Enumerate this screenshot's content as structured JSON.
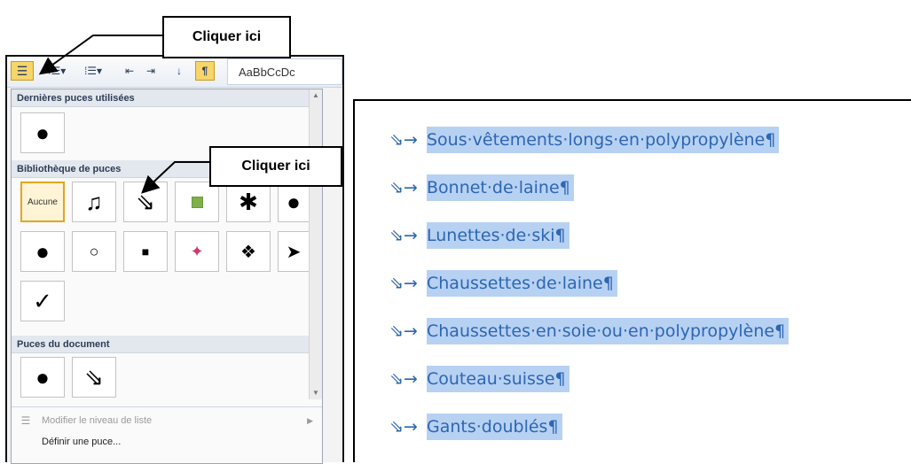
{
  "callouts": [
    "Cliquer ici",
    "Cliquer ici"
  ],
  "ribbon": {
    "styles_preview": "AaBbCcDc",
    "buttons": [
      "bullets-icon",
      "numbering-icon",
      "multilevel-list-icon",
      "decrease-indent-icon",
      "increase-indent-icon",
      "sort-icon",
      "pilcrow-icon"
    ]
  },
  "dropdown": {
    "recent_header": "Dernières puces utilisées",
    "library_header": "Bibliothèque de puces",
    "none_label": "Aucune",
    "document_header": "Puces du document",
    "change_level": "Modifier le niveau de liste",
    "define_bullet": "Définir une puce..."
  },
  "document": {
    "items": [
      "Sous·vêtements·longs·en·polypropylène¶",
      "Bonnet·de·laine¶",
      "Lunettes·de·ski¶",
      "Chaussettes·de·laine¶",
      "Chaussettes·en·soie·ou·en·polypropylène¶",
      "Couteau·suisse¶",
      "Gants·doublés¶"
    ]
  }
}
